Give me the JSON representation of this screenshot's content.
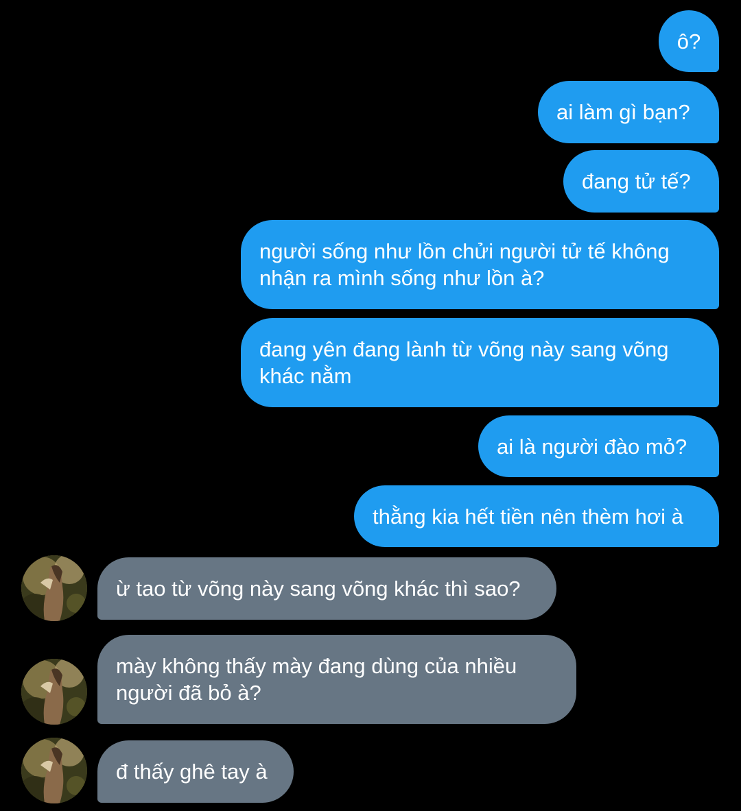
{
  "chat": {
    "sent": [
      {
        "text": "ô?"
      },
      {
        "text": "ai làm gì bạn?"
      },
      {
        "text": "đang tử tế?"
      },
      {
        "text": "người sống như lồn chửi người tử tế không\nnhận ra mình sống như lồn à?"
      },
      {
        "text": "đang yên đang lành từ võng này sang võng\nkhác nằm"
      },
      {
        "text": "ai là người đào mỏ?"
      },
      {
        "text": "thằng kia hết tiền nên thèm hơi à"
      }
    ],
    "received": [
      {
        "text": "ừ tao từ võng này sang võng khác thì sao?"
      },
      {
        "text": "mày không thấy mày đang dùng của nhiều\nngười đã bỏ à?"
      },
      {
        "text": "đ thấy ghê tay à"
      }
    ]
  },
  "colors": {
    "background": "#000000",
    "sent_bubble": "#1f9cf0",
    "received_bubble": "#677684",
    "text": "#ffffff"
  },
  "icons": {
    "avatar": "contact-avatar-photo"
  }
}
